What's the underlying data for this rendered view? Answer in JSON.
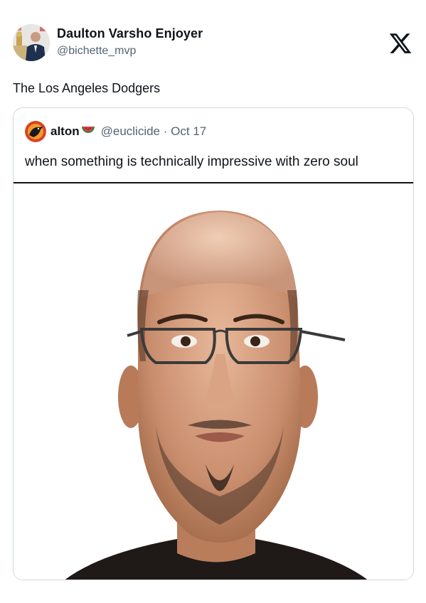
{
  "tweet": {
    "author": {
      "display_name": "Daulton Varsho Enjoyer",
      "handle": "@bichette_mvp",
      "avatar_icon": "profile-photo-avatar"
    },
    "text": "The Los Angeles Dodgers",
    "platform_logo": "x-logo-icon"
  },
  "quoted_tweet": {
    "author": {
      "display_name": "alton",
      "emoji": "watermelon-icon",
      "handle": "@euclicide",
      "avatar_icon": "bird-avatar"
    },
    "separator": "·",
    "date": "Oct 17",
    "text": "when something is technically impressive with zero soul",
    "media": "portrait-photo"
  },
  "colors": {
    "text_primary": "#0f1419",
    "text_secondary": "#536471",
    "border": "#cfd9de"
  }
}
